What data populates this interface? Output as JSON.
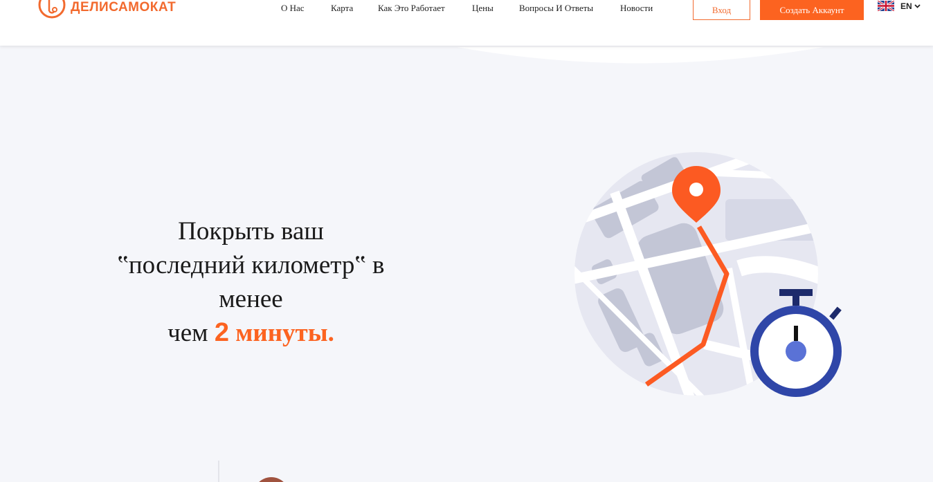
{
  "brand": {
    "name": "ДЕЛИСАМОКАТ",
    "accent_color": "#fc6320",
    "logo_icon": "scooter-logo-icon"
  },
  "nav": {
    "items": [
      {
        "label": "О Нас"
      },
      {
        "label": "Карта"
      },
      {
        "label": "Как Это Работает"
      },
      {
        "label": "Цены"
      },
      {
        "label": "Вопросы И Ответы"
      },
      {
        "label": "Новости"
      }
    ]
  },
  "auth": {
    "login_label": "Вход",
    "signup_label": "Создать Аккаунт"
  },
  "language": {
    "code": "EN",
    "flag_icon": "uk-flag-icon",
    "chevron_icon": "chevron-down-icon"
  },
  "hero": {
    "line1": "Покрыть ваш",
    "line2": "‟последний километр‟ в",
    "line3": "менее",
    "line4_prefix": "чем",
    "line4_number": "2",
    "line4_accent": "минуты."
  },
  "illustration": {
    "map_icon": "map-route-icon",
    "pin_icon": "location-pin-icon",
    "stopwatch_icon": "stopwatch-icon"
  }
}
